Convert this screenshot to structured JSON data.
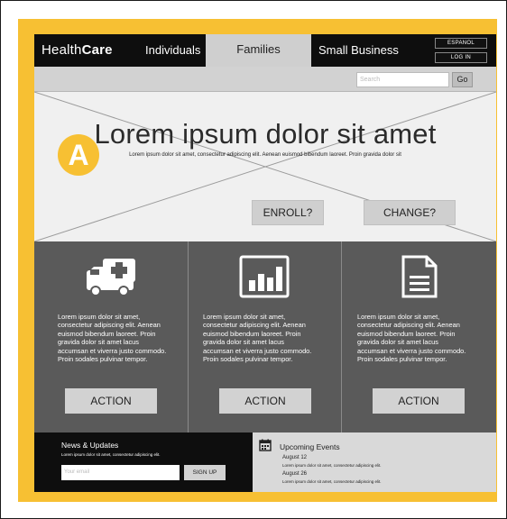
{
  "nav": {
    "logo_light": "Health",
    "logo_bold": "Care",
    "items": [
      "Individuals",
      "Families",
      "Small Business"
    ],
    "active_index": 1,
    "espanol": "ESPANOL",
    "login": "LOG IN"
  },
  "search": {
    "placeholder": "Search",
    "go": "Go"
  },
  "hero": {
    "badge": "A",
    "title": "Lorem ipsum dolor sit amet",
    "subtitle": "Lorem ipsum dolor sit amet, consectetur adipiscing elit. Aenean euismod bibendum laoreet. Proin gravida dolor sit",
    "enroll": "ENROLL?",
    "change": "CHANGE?"
  },
  "features": [
    {
      "icon": "ambulance-icon",
      "text": "Lorem ipsum dolor sit amet, consectetur adipiscing elit. Aenean euismod bibendum laoreet. Proin gravida dolor sit amet lacus accumsan et viverra justo commodo. Proin sodales pulvinar tempor.",
      "action": "ACTION"
    },
    {
      "icon": "bar-chart-icon",
      "text": "Lorem ipsum dolor sit amet, consectetur adipiscing elit. Aenean euismod bibendum laoreet. Proin gravida dolor sit amet lacus accumsan et viverra justo commodo. Proin sodales pulvinar tempor.",
      "action": "ACTION"
    },
    {
      "icon": "document-icon",
      "text": "Lorem ipsum dolor sit amet, consectetur adipiscing elit. Aenean euismod bibendum laoreet. Proin gravida dolor sit amet lacus accumsan et viverra justo commodo. Proin sodales pulvinar tempor.",
      "action": "ACTION"
    }
  ],
  "news": {
    "title": "News & Updates",
    "subtitle": "Lorem ipsum dolor sit amet, consectetur adipiscing elit.",
    "email_placeholder": "Your email",
    "signup": "SIGN UP"
  },
  "events": {
    "title": "Upcoming Events",
    "items": [
      {
        "date": "August 12",
        "text": "Lorem ipsum dolor sit amet, consectetur adipiscing elit."
      },
      {
        "date": "August 26",
        "text": "Lorem ipsum dolor sit amet, consectetur adipiscing elit."
      }
    ]
  },
  "colors": {
    "accent": "#f7c033",
    "dark": "#0e0e0e",
    "panel": "#5a5a5a"
  }
}
